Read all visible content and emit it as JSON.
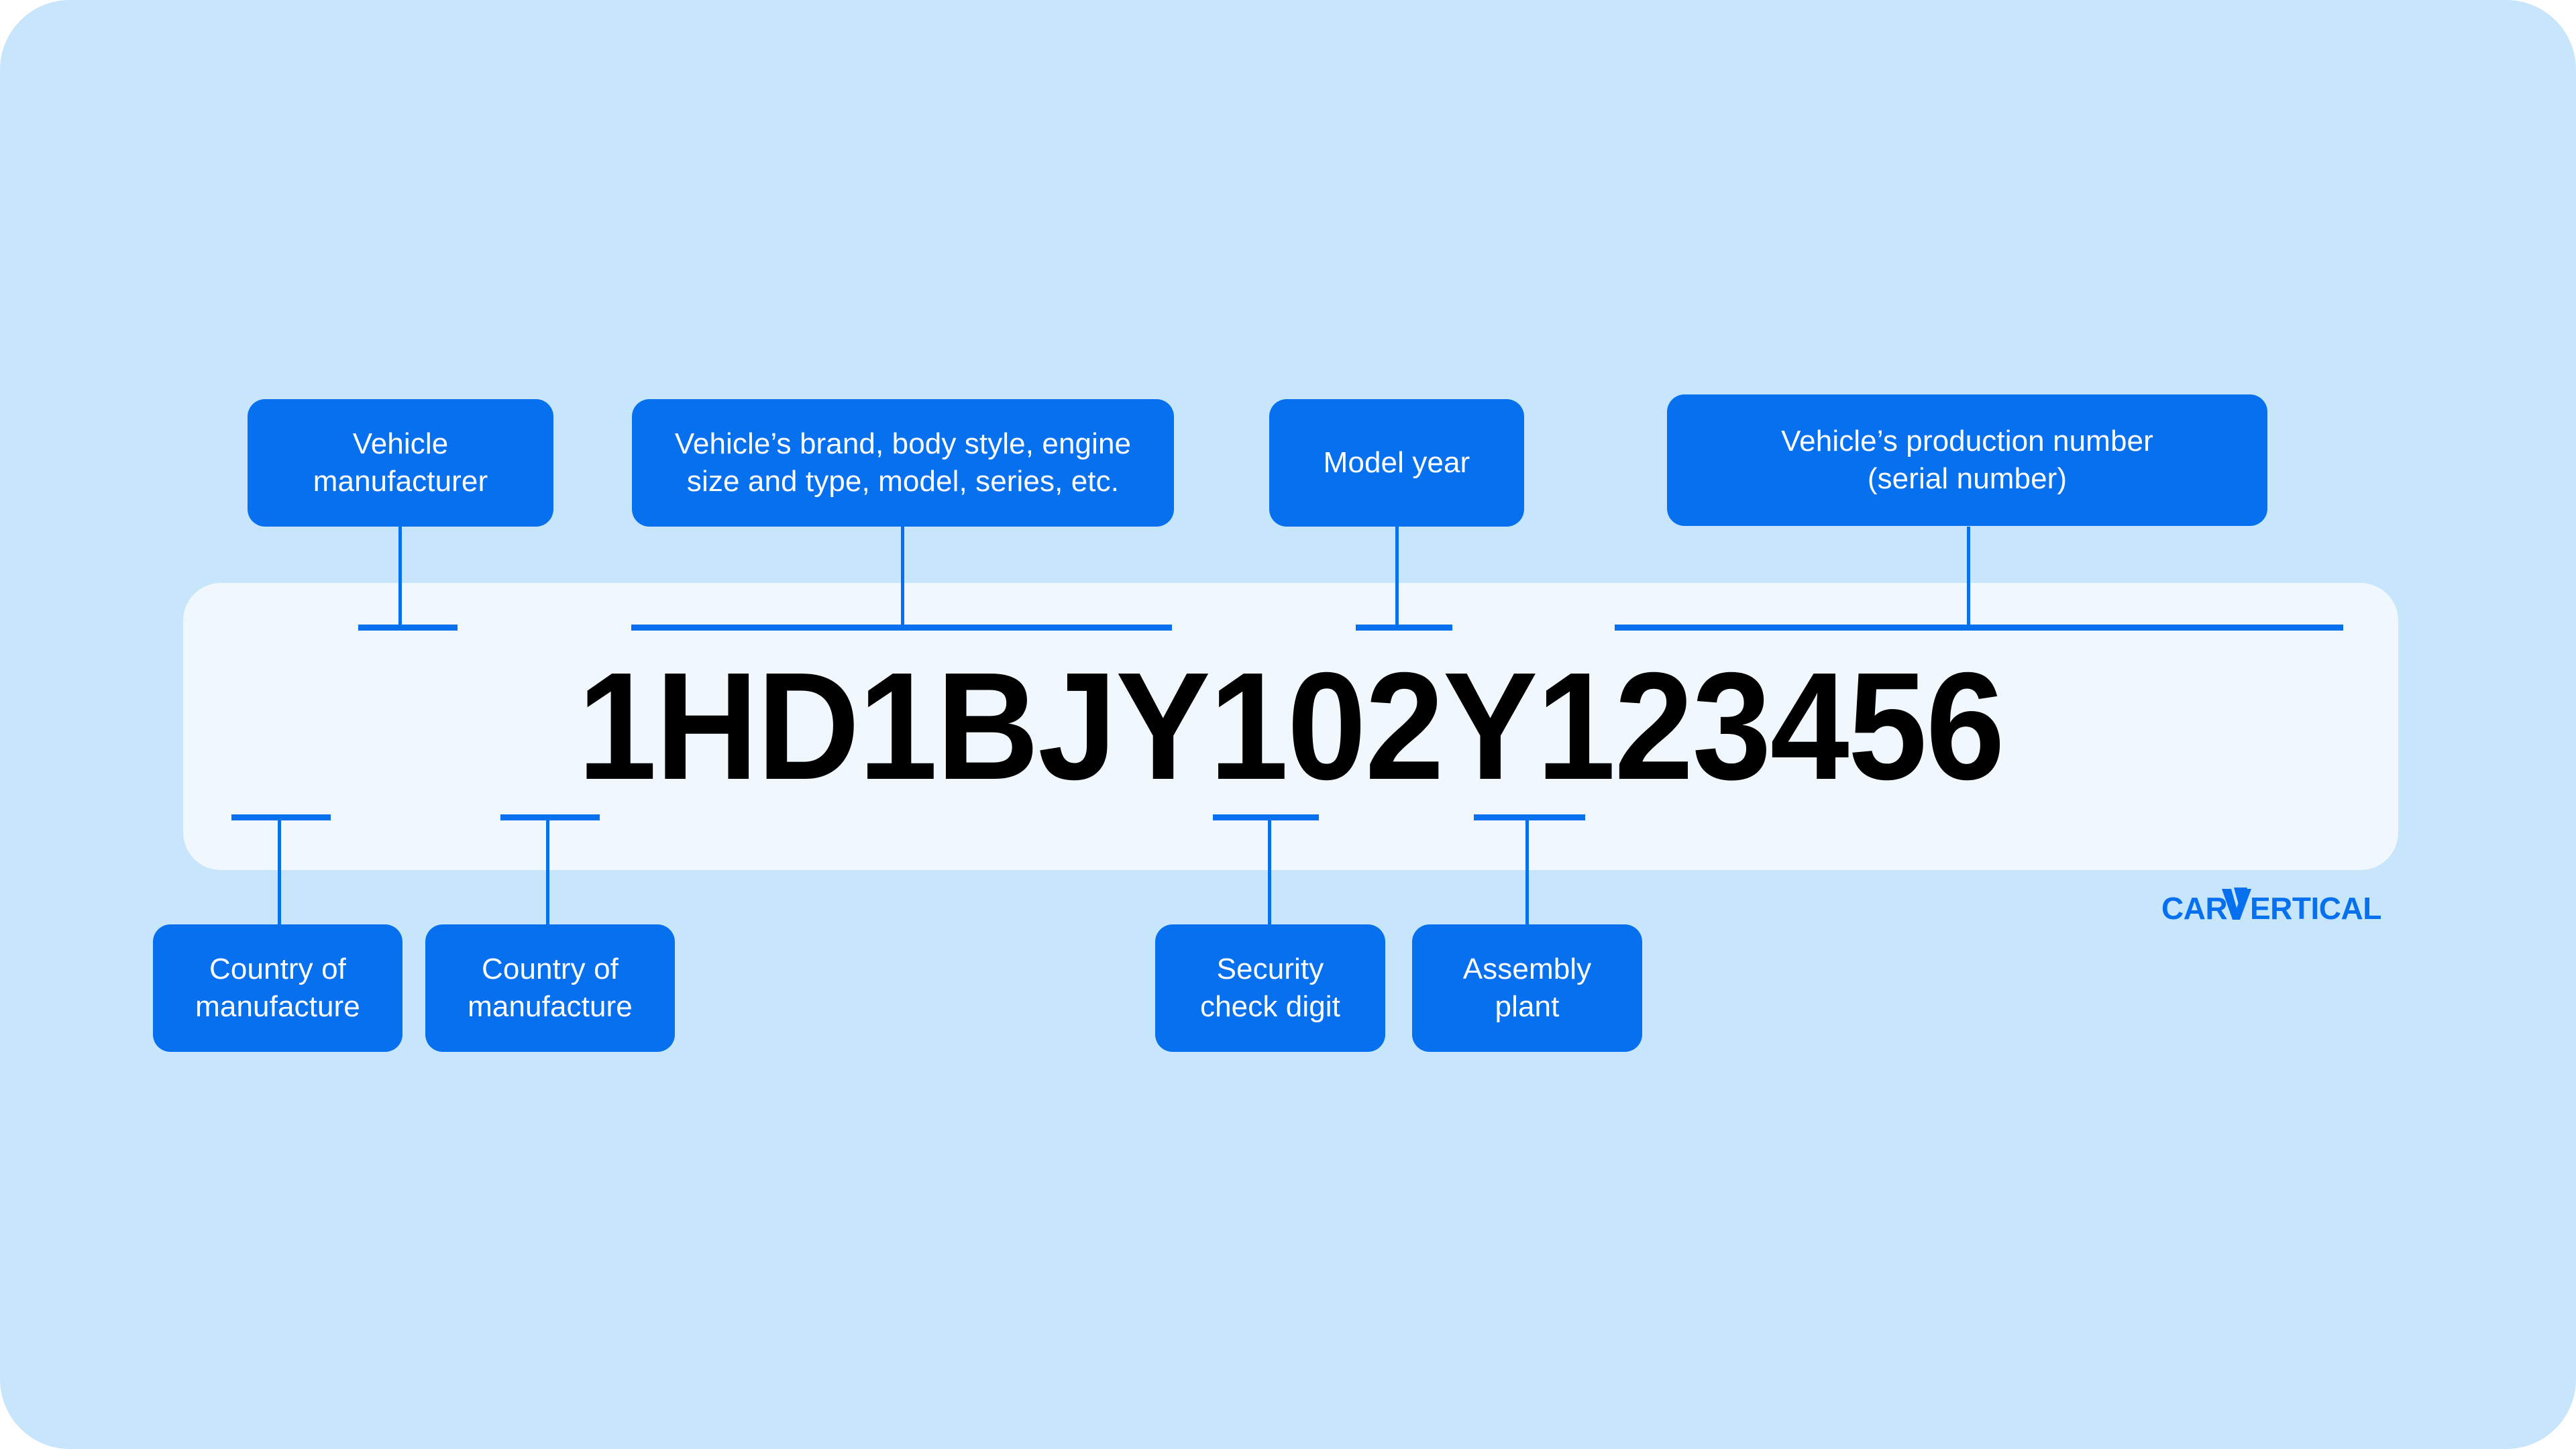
{
  "theme": {
    "panel_background": "#c7e5fb",
    "card_background": "#f0f7fd",
    "accent_blue": "#0670ef",
    "vin_text_color": "#000000",
    "label_text_color": "#ffffff"
  },
  "vin": {
    "value": "1HD1BJY102Y123456",
    "characters": [
      "1",
      "H",
      "D",
      "1",
      "B",
      "J",
      "Y",
      "1",
      "0",
      "2",
      "Y",
      "1",
      "2",
      "3",
      "4",
      "5",
      "6"
    ]
  },
  "labels_top": [
    {
      "id": "vehicle-manufacturer",
      "text": "Vehicle manufacturer",
      "lines": [
        "Vehicle",
        "manufacturer"
      ]
    },
    {
      "id": "vehicle-descriptor",
      "text": "Vehicle’s brand, body style, engine size and type, model, series, etc.",
      "lines": [
        "Vehicle’s brand, body style, engine",
        "size and type, model, series, etc."
      ]
    },
    {
      "id": "model-year",
      "text": "Model year",
      "lines": [
        "Model year"
      ]
    },
    {
      "id": "production-number",
      "text": "Vehicle’s production number (serial number)",
      "lines": [
        "Vehicle’s production number",
        "(serial number)"
      ]
    }
  ],
  "labels_bottom": [
    {
      "id": "country-of-manufacture-1",
      "text": "Country of manufacture",
      "lines": [
        "Country of",
        "manufacture"
      ]
    },
    {
      "id": "country-of-manufacture-2",
      "text": "Country of manufacture",
      "lines": [
        "Country of",
        "manufacture"
      ]
    },
    {
      "id": "security-check-digit",
      "text": "Security check digit",
      "lines": [
        "Security",
        "check digit"
      ]
    },
    {
      "id": "assembly-plant",
      "text": "Assembly plant",
      "lines": [
        "Assembly",
        "plant"
      ]
    }
  ],
  "brand": {
    "name": "carVertical",
    "wordmark": "CARVERTICAL",
    "color": "#0670ef"
  }
}
